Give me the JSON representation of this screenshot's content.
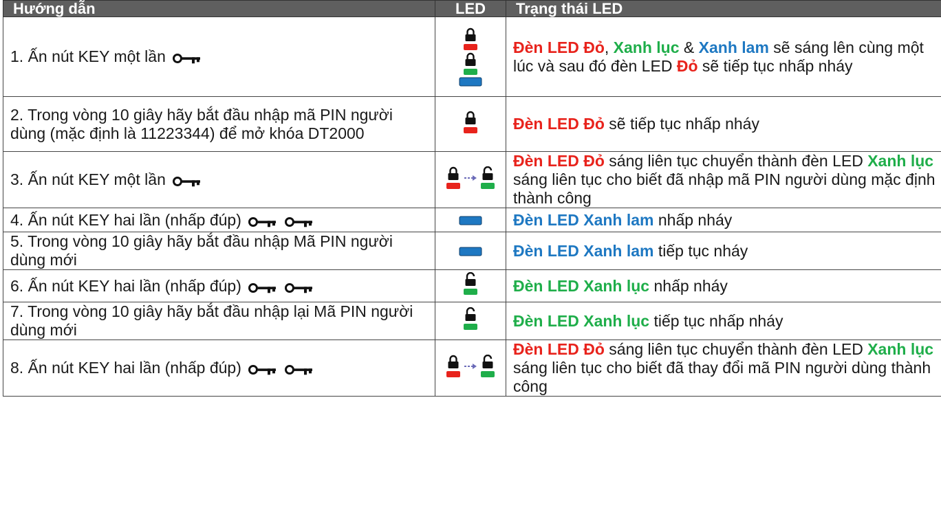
{
  "header": {
    "instructions": "Hướng dẫn",
    "led": "LED",
    "state": "Trạng thái LED"
  },
  "colors": {
    "red": "#e8231c",
    "green": "#1fae4a",
    "blue": "#1e78c2",
    "header_bg": "#5f5f5f"
  },
  "icons": {
    "key": "key-icon",
    "lock": "padlock-icon",
    "arrow": "arrow-right-icon"
  },
  "rows": [
    {
      "step": "1. Ấn nút KEY một lần",
      "led": "red-green-blue",
      "state": [
        {
          "t": "Đèn LED Đỏ",
          "c": "red"
        },
        {
          "t": ", "
        },
        {
          "t": "Xanh lục",
          "c": "green"
        },
        {
          "t": " & "
        },
        {
          "t": "Xanh lam",
          "c": "blue"
        },
        {
          "t": " sẽ sáng lên cùng một lúc và sau đó đèn LED "
        },
        {
          "t": "Đỏ",
          "c": "red"
        },
        {
          "t": " sẽ tiếp tục nhấp nháy"
        }
      ]
    },
    {
      "step": "2. Trong vòng 10 giây hãy bắt đầu nhập mã PIN người dùng (mặc định là 11223344) để mở khóa DT2000",
      "led": "red",
      "state": [
        {
          "t": "Đèn LED Đỏ",
          "c": "red"
        },
        {
          "t": " sẽ tiếp tục nhấp nháy"
        }
      ]
    },
    {
      "step": "3. Ấn nút KEY một lần",
      "led": "red-to-green",
      "state": [
        {
          "t": "Đèn LED Đỏ",
          "c": "red"
        },
        {
          "t": " sáng liên tục chuyển thành đèn LED "
        },
        {
          "t": "Xanh lục",
          "c": "green"
        },
        {
          "t": " sáng liên tục cho biết đã nhập mã PIN người dùng mặc định thành công"
        }
      ]
    },
    {
      "step": "4. Ấn nút KEY hai lần (nhấp đúp)",
      "led": "blue",
      "state": [
        {
          "t": "Đèn LED Xanh lam",
          "c": "blue"
        },
        {
          "t": " nhấp nháy"
        }
      ]
    },
    {
      "step": "5. Trong vòng 10 giây hãy bắt đầu nhập Mã PIN người dùng mới",
      "led": "blue",
      "state": [
        {
          "t": "Đèn LED Xanh lam",
          "c": "blue"
        },
        {
          "t": " tiếp tục nháy"
        }
      ]
    },
    {
      "step": "6. Ấn nút KEY hai lần (nhấp đúp)",
      "led": "green",
      "state": [
        {
          "t": "Đèn LED Xanh lục",
          "c": "green"
        },
        {
          "t": " nhấp nháy"
        }
      ]
    },
    {
      "step": "7. Trong vòng 10 giây hãy bắt đầu nhập lại Mã PIN người dùng mới",
      "led": "green",
      "state": [
        {
          "t": "Đèn LED Xanh lục",
          "c": "green"
        },
        {
          "t": " tiếp tục nhấp nháy"
        }
      ]
    },
    {
      "step": "8. Ấn nút KEY hai lần (nhấp đúp)",
      "led": "red-to-green",
      "state": [
        {
          "t": "Đèn LED Đỏ",
          "c": "red"
        },
        {
          "t": " sáng liên tục chuyển thành đèn LED "
        },
        {
          "t": "Xanh lục",
          "c": "green"
        },
        {
          "t": " sáng liên tục cho biết đã thay đổi mã PIN người dùng thành công"
        }
      ]
    }
  ]
}
